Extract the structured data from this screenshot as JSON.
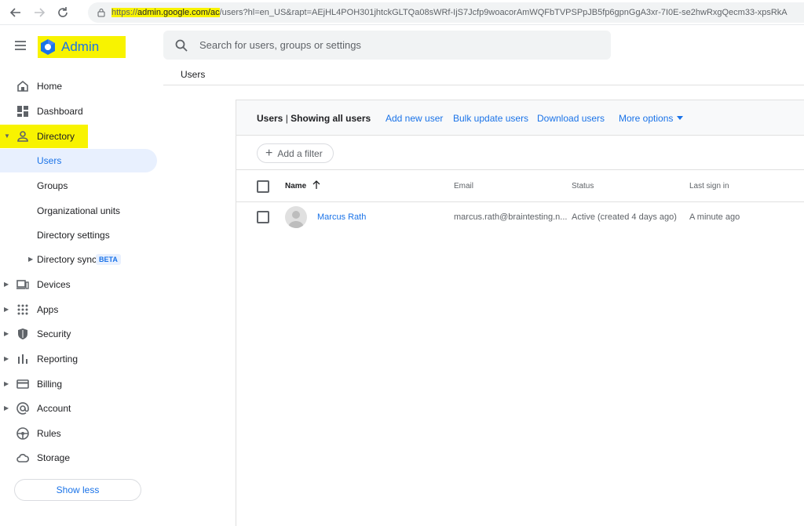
{
  "browser": {
    "url_scheme": "https://",
    "url_host": "admin.google.com/ac",
    "url_path": "/users?hl=en_US&rapt=AEjHL4POH301jhtckGLTQa08sWRf-IjS7Jcfp9woacorAmWQFbTVPSPpJB5fp6gpnGgA3xr-7I0E-se2hwRxgQecm33-xpsRkA"
  },
  "header": {
    "app_name": "Admin",
    "search_placeholder": "Search for users, groups or settings",
    "breadcrumb": "Users"
  },
  "sidebar": {
    "items": [
      {
        "label": "Home",
        "icon": "home-icon"
      },
      {
        "label": "Dashboard",
        "icon": "dashboard-icon"
      },
      {
        "label": "Directory",
        "icon": "person-icon"
      },
      {
        "label": "Users"
      },
      {
        "label": "Groups"
      },
      {
        "label": "Organizational units"
      },
      {
        "label": "Directory settings"
      },
      {
        "label": "Directory sync",
        "badge": "BETA"
      },
      {
        "label": "Devices",
        "icon": "devices-icon"
      },
      {
        "label": "Apps",
        "icon": "apps-grid-icon"
      },
      {
        "label": "Security",
        "icon": "shield-icon"
      },
      {
        "label": "Reporting",
        "icon": "bar-chart-icon"
      },
      {
        "label": "Billing",
        "icon": "credit-card-icon"
      },
      {
        "label": "Account",
        "icon": "at-sign-icon"
      },
      {
        "label": "Rules",
        "icon": "steering-icon"
      },
      {
        "label": "Storage",
        "icon": "cloud-icon"
      }
    ],
    "show_less": "Show less"
  },
  "users": {
    "title": "Users",
    "subtitle": "Showing all users",
    "actions": {
      "add_new_user": "Add new user",
      "bulk_update": "Bulk update users",
      "download": "Download users",
      "more_options": "More options"
    },
    "filter_label": "Add a filter",
    "columns": {
      "name": "Name",
      "email": "Email",
      "status": "Status",
      "last_sign_in": "Last sign in"
    },
    "rows": [
      {
        "name": "Marcus Rath",
        "email": "marcus.rath@braintesting.n...",
        "status": "Active (created 4 days ago)",
        "last_sign_in": "A minute ago"
      }
    ]
  },
  "colors": {
    "accent": "#1a73e8",
    "highlight": "#f8f300",
    "active_bg": "#e8f0fe"
  }
}
